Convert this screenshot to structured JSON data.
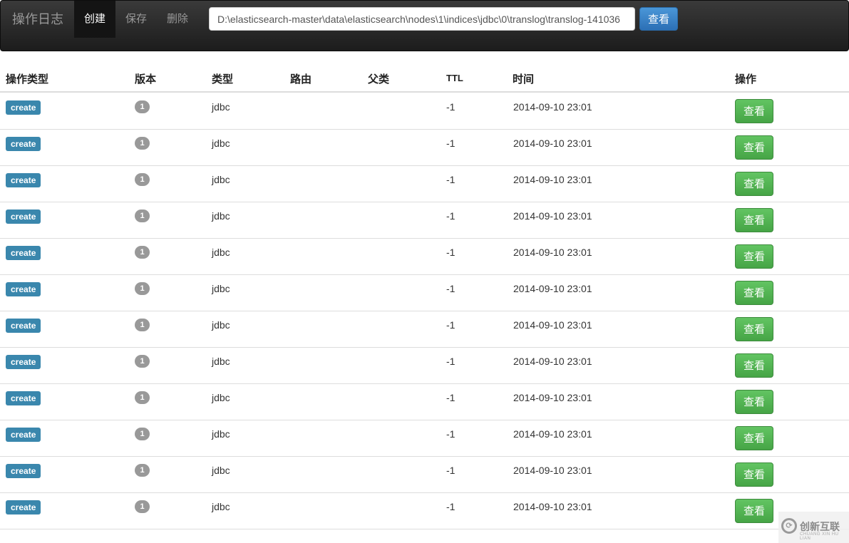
{
  "navbar": {
    "brand": "操作日志",
    "items": [
      {
        "label": "创建",
        "active": true
      },
      {
        "label": "保存",
        "active": false
      },
      {
        "label": "删除",
        "active": false
      }
    ],
    "path_value": "D:\\elasticsearch-master\\data\\elasticsearch\\nodes\\1\\indices\\jdbc\\0\\translog\\translog-141036",
    "view_label": "查看"
  },
  "table": {
    "headers": [
      "操作类型",
      "版本",
      "类型",
      "路由",
      "父类",
      "TTL",
      "时间",
      "操作"
    ],
    "rows": [
      {
        "op": "create",
        "version": "1",
        "type": "jdbc",
        "routing": "",
        "parent": "",
        "ttl": "-1",
        "time": "2014-09-10 23:01",
        "action": "查看"
      },
      {
        "op": "create",
        "version": "1",
        "type": "jdbc",
        "routing": "",
        "parent": "",
        "ttl": "-1",
        "time": "2014-09-10 23:01",
        "action": "查看"
      },
      {
        "op": "create",
        "version": "1",
        "type": "jdbc",
        "routing": "",
        "parent": "",
        "ttl": "-1",
        "time": "2014-09-10 23:01",
        "action": "查看"
      },
      {
        "op": "create",
        "version": "1",
        "type": "jdbc",
        "routing": "",
        "parent": "",
        "ttl": "-1",
        "time": "2014-09-10 23:01",
        "action": "查看"
      },
      {
        "op": "create",
        "version": "1",
        "type": "jdbc",
        "routing": "",
        "parent": "",
        "ttl": "-1",
        "time": "2014-09-10 23:01",
        "action": "查看"
      },
      {
        "op": "create",
        "version": "1",
        "type": "jdbc",
        "routing": "",
        "parent": "",
        "ttl": "-1",
        "time": "2014-09-10 23:01",
        "action": "查看"
      },
      {
        "op": "create",
        "version": "1",
        "type": "jdbc",
        "routing": "",
        "parent": "",
        "ttl": "-1",
        "time": "2014-09-10 23:01",
        "action": "查看"
      },
      {
        "op": "create",
        "version": "1",
        "type": "jdbc",
        "routing": "",
        "parent": "",
        "ttl": "-1",
        "time": "2014-09-10 23:01",
        "action": "查看"
      },
      {
        "op": "create",
        "version": "1",
        "type": "jdbc",
        "routing": "",
        "parent": "",
        "ttl": "-1",
        "time": "2014-09-10 23:01",
        "action": "查看"
      },
      {
        "op": "create",
        "version": "1",
        "type": "jdbc",
        "routing": "",
        "parent": "",
        "ttl": "-1",
        "time": "2014-09-10 23:01",
        "action": "查看"
      },
      {
        "op": "create",
        "version": "1",
        "type": "jdbc",
        "routing": "",
        "parent": "",
        "ttl": "-1",
        "time": "2014-09-10 23:01",
        "action": "查看"
      },
      {
        "op": "create",
        "version": "1",
        "type": "jdbc",
        "routing": "",
        "parent": "",
        "ttl": "-1",
        "time": "2014-09-10 23:01",
        "action": "查看"
      }
    ]
  },
  "watermark": {
    "text": "创新互联",
    "sub": "CHUANG XIN HU LIAN",
    "logo_icon": "chuangxin-logo-icon"
  },
  "colors": {
    "navbar_bg": "#222222",
    "label_create": "#3a87ad",
    "badge": "#999999",
    "btn_primary": "#2c6fb5",
    "btn_success": "#46a546"
  }
}
